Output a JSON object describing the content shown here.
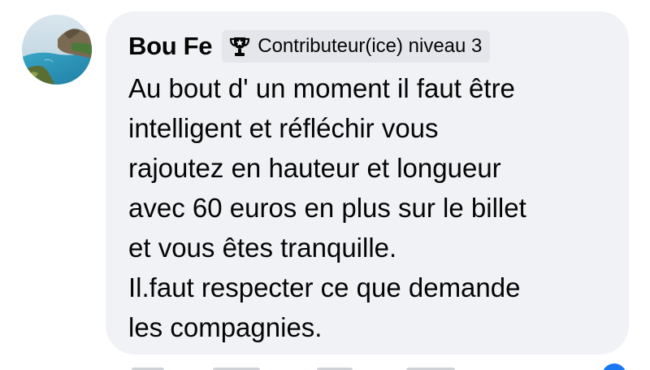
{
  "comment": {
    "author": "Bou Fe",
    "badge": {
      "icon": "trophy-icon",
      "label": "Contributeur(ice) niveau 3"
    },
    "lines": [
      "Au bout d' un moment il faut être",
      "intelligent et réfléchir vous",
      "rajoutez en hauteur et longueur",
      "avec 60 euros en plus sur le billet",
      "et vous êtes tranquille.",
      "Il.faut respecter ce que demande",
      "les compagnies."
    ]
  },
  "colors": {
    "bubble_background": "#f0f2f5",
    "badge_background": "#e4e6eb",
    "text": "#050505",
    "reaction_accent": "#1877f2"
  }
}
